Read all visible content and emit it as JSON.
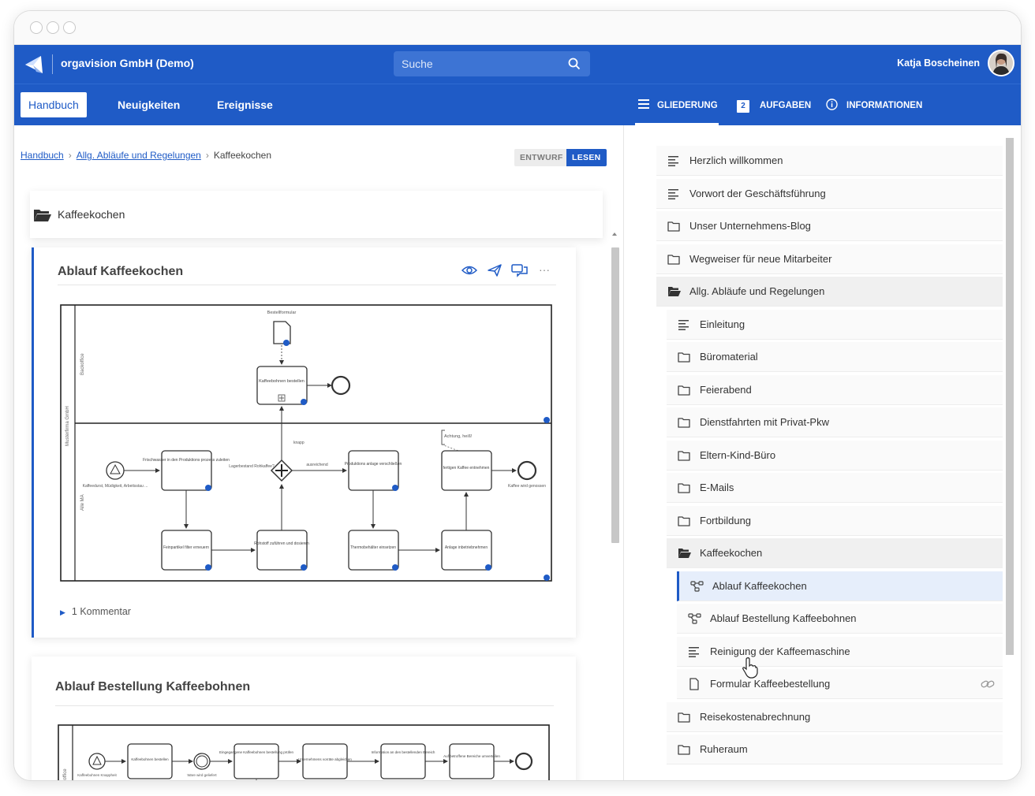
{
  "app": {
    "org_name": "orgavision GmbH (Demo)",
    "search_placeholder": "Suche",
    "user_name": "Katja Boscheinen"
  },
  "nav": {
    "tabs": [
      "Handbuch",
      "Neuigkeiten",
      "Ereignisse"
    ],
    "right_tabs": [
      {
        "label": "GLIEDERUNG",
        "icon": "list-icon"
      },
      {
        "label": "AUFGABEN",
        "badge": "2"
      },
      {
        "label": "INFORMATIONEN",
        "icon": "info-icon"
      }
    ]
  },
  "breadcrumb": [
    "Handbuch",
    "Allg. Abläufe und Regelungen",
    "Kaffeekochen"
  ],
  "status": {
    "draft": "ENTWURF",
    "read": "LESEN"
  },
  "folder_title": "Kaffeekochen",
  "card1": {
    "title": "Ablauf Kaffeekochen",
    "comment": "1 Kommentar",
    "diagram": {
      "pool": "Musterfirma GmbH",
      "lane_top": "Backoffice",
      "lane_bottom": "Alle MA",
      "doc_label": "Bestellformular",
      "order_task": "Kaffeebohnen bestellen",
      "start_label": "Kaffeedurst, Müdigkeit, Arbeitsstau ...",
      "t_fresh_water": "Frischwasser in den Produktions prozess zuleiten",
      "gateway_label": "Lagerbestand Rohkaffee?",
      "knapp": "knapp",
      "ausreichend": "ausreichend",
      "t_start_plant": "Produktions anlage verschließen",
      "annotation": "Achtung, heiß!",
      "t_take_coffee": "fertigen Kaffee entnehmen",
      "end_label": "Kaffee wird genossen",
      "t_filter": "Feinpartikel filter erneuern",
      "t_raw": "Rohstoff zuführen und dosieren",
      "t_thermo": "Thermobehälter einsetzen",
      "t_plant_on": "Anlage inbetriebnehmen"
    }
  },
  "card2": {
    "title": "Ablauf Bestellung Kaffeebohnen",
    "diagram": {
      "lane": "ackoffice",
      "start_label": "Kaffeebohnen Knappheit",
      "t1": "Kaffeebohnen bestellen",
      "wait_label": "Ware wird geliefert",
      "t2": "Eingegangene Kaffeebohnen bestellung prüfen",
      "t3": "Unternehmens vorräte abgleichen",
      "t4": "Information an den bestellenden Bereich",
      "t5": "Auf betroffene Bereiche umverteilen"
    }
  },
  "sidebar": {
    "items": [
      {
        "label": "Herzlich willkommen",
        "icon": "text-lines-icon",
        "indent": 0
      },
      {
        "label": "Vorwort der Geschäftsführung",
        "icon": "text-lines-icon",
        "indent": 0
      },
      {
        "label": "Unser Unternehmens-Blog",
        "icon": "folder-icon",
        "indent": 0
      },
      {
        "label": "Wegweiser für neue Mitarbeiter",
        "icon": "folder-icon",
        "indent": 0
      },
      {
        "label": "Allg. Abläufe und Regelungen",
        "icon": "folder-open-icon",
        "indent": 0,
        "state": "expanded"
      },
      {
        "label": "Einleitung",
        "icon": "text-lines-icon",
        "indent": 1
      },
      {
        "label": "Büromaterial",
        "icon": "folder-icon",
        "indent": 1
      },
      {
        "label": "Feierabend",
        "icon": "folder-icon",
        "indent": 1
      },
      {
        "label": "Dienstfahrten mit Privat-Pkw",
        "icon": "folder-icon",
        "indent": 1
      },
      {
        "label": "Eltern-Kind-Büro",
        "icon": "folder-icon",
        "indent": 1
      },
      {
        "label": "E-Mails",
        "icon": "folder-icon",
        "indent": 1
      },
      {
        "label": "Fortbildung",
        "icon": "folder-icon",
        "indent": 1
      },
      {
        "label": "Kaffeekochen",
        "icon": "folder-open-icon",
        "indent": 1,
        "state": "expanded"
      },
      {
        "label": "Ablauf Kaffeekochen",
        "icon": "process-icon",
        "indent": 2,
        "state": "selected"
      },
      {
        "label": "Ablauf Bestellung Kaffeebohnen",
        "icon": "process-icon",
        "indent": 2
      },
      {
        "label": "Reinigung der Kaffeemaschine",
        "icon": "text-lines-icon",
        "indent": 2
      },
      {
        "label": "Formular Kaffeebestellung",
        "icon": "document-icon",
        "indent": 2,
        "link": true
      },
      {
        "label": "Reisekostenabrechnung",
        "icon": "folder-icon",
        "indent": 1
      },
      {
        "label": "Ruheraum",
        "icon": "folder-icon",
        "indent": 1
      }
    ]
  },
  "colors": {
    "brand": "#1f5bc6"
  }
}
